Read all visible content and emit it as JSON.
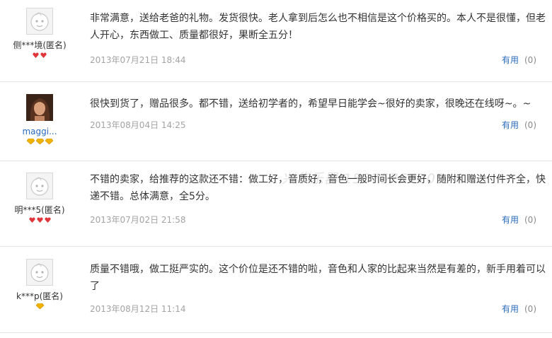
{
  "reviews": [
    {
      "username": "侧***境(匿名)",
      "avatar_icon": "default-face-icon",
      "badges": [
        "heart-badge-icon",
        "heart-badge-icon"
      ],
      "text": "非常满意，送给老爸的礼物。发货很快。老人拿到后怎么也不相信是这个价格买的。本人不是很懂，但老人开心，东西做工、质量都很好，果断全五分！",
      "date": "2013年07月21日 18:44",
      "useful_label": "有用",
      "useful_count": "(0)"
    },
    {
      "username": "maggi...",
      "avatar_icon": "user-photo-icon",
      "badges": [
        "diamond-badge-icon",
        "diamond-badge-icon",
        "diamond-badge-icon"
      ],
      "text": "很快到货了，赠品很多。都不错，送给初学者的，希望早日能学会~很好的卖家，很晚还在线呀~。~",
      "date": "2013年08月04日 14:25",
      "useful_label": "有用",
      "useful_count": "(0)"
    },
    {
      "username": "明***5(匿名)",
      "avatar_icon": "default-face-icon",
      "badges": [
        "heart-badge-icon",
        "heart-badge-icon",
        "heart-badge-icon"
      ],
      "text": "不错的卖家，给推荐的这款还不错：做工好，音质好，音色一般时间长会更好，随附和赠送付件齐全，快递不错。总体满意，全5分。",
      "date": "2013年07月02日 21:58",
      "useful_label": "有用",
      "useful_count": "(0)"
    },
    {
      "username": "k***p(匿名)",
      "avatar_icon": "default-face-icon",
      "badges": [
        "diamond-badge-icon"
      ],
      "text": "质量不错哦，做工挺严实的。这个价位是还不错的啦，音色和人家的比起来当然是有差的，新手用着可以了",
      "date": "2013年08月12日 11:14",
      "useful_label": "有用",
      "useful_count": "(0)"
    }
  ],
  "watermark": "兴华乐器 15075767705",
  "colors": {
    "link": "#2a6bbd",
    "date": "#a3a3a3",
    "heart": "#e0353a",
    "diamond": "#f0b400"
  }
}
